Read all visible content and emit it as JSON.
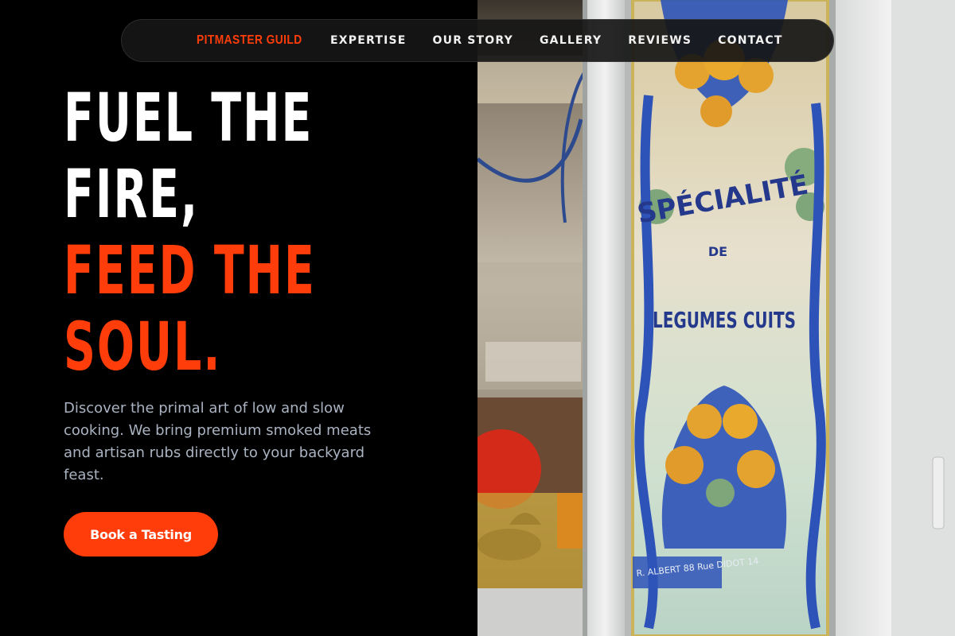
{
  "nav": {
    "brand": "PITMASTER GUILD",
    "links": [
      "EXPERTISE",
      "OUR STORY",
      "GALLERY",
      "REVIEWS",
      "CONTACT"
    ]
  },
  "hero": {
    "headline_white": [
      "FUEL THE",
      "FIRE,"
    ],
    "headline_accent": [
      "FEED THE",
      "SOUL."
    ],
    "description": "Discover the primal art of low and slow cooking. We bring premium smoked meats and artisan rubs directly to your backyard feast.",
    "cta_label": "Book a Tasting"
  },
  "photo": {
    "sign_title": "SPÉCIALITÉ",
    "sign_de": "DE",
    "sign_subtitle": "LEGUMES CUITS",
    "sign_credit": "R. ALBERT 88 Rue DIDOT 14"
  },
  "colors": {
    "accent": "#ff3d0a",
    "background": "#000000",
    "nav_background": "#161616",
    "body_text": "#aab3c2"
  }
}
